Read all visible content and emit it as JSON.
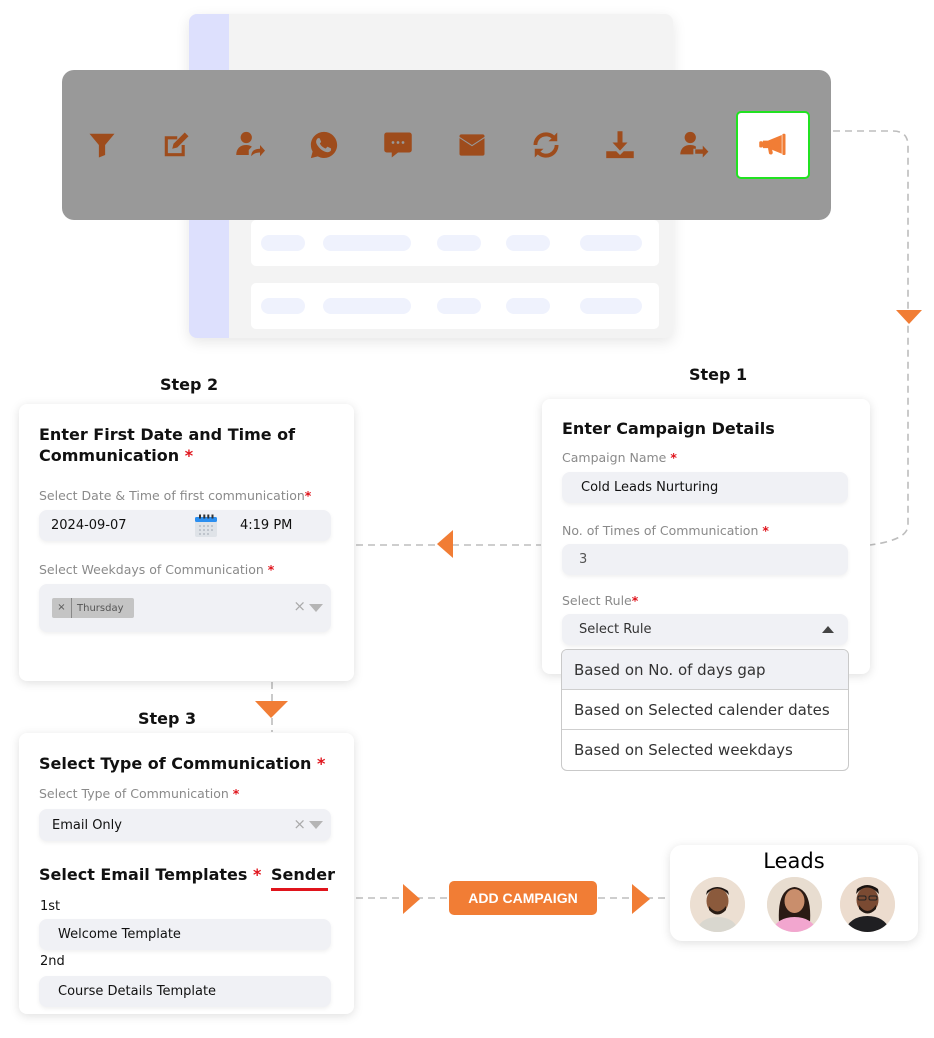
{
  "toolbar": {
    "tools": [
      {
        "icon": "filter-icon",
        "label": "Filter"
      },
      {
        "icon": "edit-icon",
        "label": "Edit"
      },
      {
        "icon": "user-share-icon",
        "label": "Assign"
      },
      {
        "icon": "whatsapp-icon",
        "label": "WhatsApp"
      },
      {
        "icon": "sms-icon",
        "label": "SMS"
      },
      {
        "icon": "email-icon",
        "label": "Email"
      },
      {
        "icon": "sync-icon",
        "label": "Sync"
      },
      {
        "icon": "download-icon",
        "label": "Download"
      },
      {
        "icon": "user-transfer-icon",
        "label": "Transfer"
      },
      {
        "icon": "megaphone-icon",
        "label": "Campaign",
        "active": true
      }
    ],
    "active_border_color": "#21e221"
  },
  "colors": {
    "accent": "#f17d35",
    "icon": "#9e4c1c",
    "required": "#e0141c",
    "toolbar_bg": "#999999"
  },
  "step1": {
    "step_label": "Step 1",
    "title": "Enter Campaign Details",
    "campaign_name_label": "Campaign Name",
    "campaign_name_value": "Cold Leads Nurturing",
    "times_label": "No. of Times of Communication",
    "times_value": "3",
    "rule_label": "Select Rule",
    "rule_placeholder": "Select Rule",
    "rule_options": [
      "Based on No. of days gap",
      "Based on Selected calender dates",
      "Based on Selected weekdays"
    ],
    "required_mark": "*"
  },
  "step2": {
    "step_label": "Step 2",
    "title_line1": "Enter First Date and Time of",
    "title_line2": "Communication",
    "datetime_label": "Select Date & Time of first communication",
    "date_value": "2024-09-07",
    "time_value": "4:19 PM",
    "weekdays_label": "Select Weekdays of Communication",
    "weekday_chips": [
      "Thursday"
    ],
    "chip_remove": "×",
    "clear_symbol": "×",
    "required_mark": "*"
  },
  "step3": {
    "step_label": "Step 3",
    "title": "Select Type of Communication",
    "type_label": "Select Type of Communication",
    "type_value": "Email Only",
    "templates_title": "Select Email Templates",
    "sender_label": "Sender",
    "templates": [
      {
        "order": "1st",
        "name": "Welcome Template"
      },
      {
        "order": "2nd",
        "name": "Course Details Template"
      }
    ],
    "clear_symbol": "×",
    "required_mark": "*"
  },
  "add_campaign": {
    "label": "ADD CAMPAIGN"
  },
  "leads": {
    "title": "Leads",
    "people": [
      {
        "name": "lead-1"
      },
      {
        "name": "lead-2"
      },
      {
        "name": "lead-3"
      }
    ]
  }
}
